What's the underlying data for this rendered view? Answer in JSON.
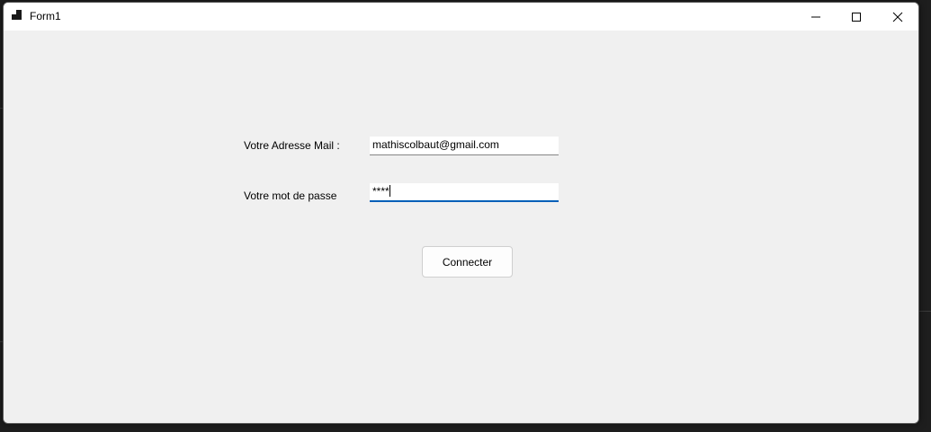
{
  "window": {
    "title": "Form1"
  },
  "form": {
    "email_label": "Votre Adresse Mail :",
    "email_value": "mathiscolbaut@gmail.com",
    "password_label": "Votre mot de passe",
    "password_value": "****",
    "connect_label": "Connecter"
  },
  "icons": {
    "app": "app-window-icon",
    "minimize": "minimize-icon",
    "maximize": "maximize-icon",
    "close": "close-icon"
  },
  "colors": {
    "focus_underline": "#005fb8",
    "client_bg": "#f0f0f0"
  }
}
